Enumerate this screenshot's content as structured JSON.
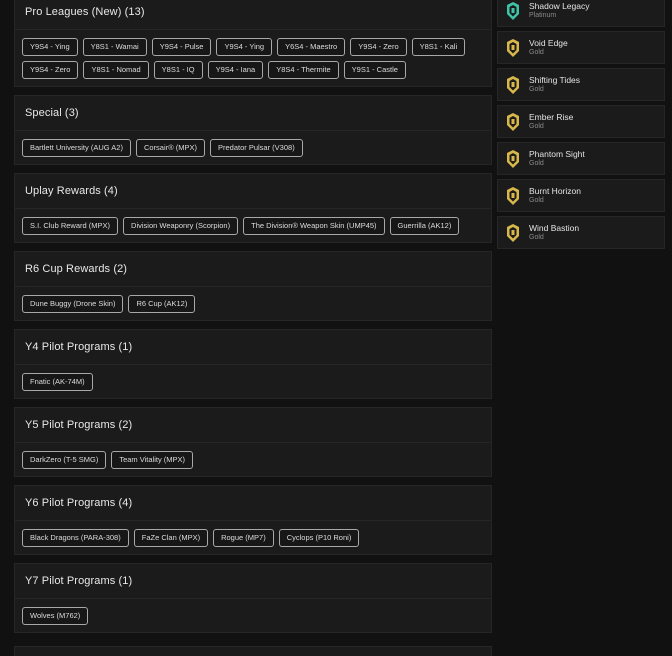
{
  "sections": [
    {
      "title": "Pro Leagues (New) (13)",
      "items": [
        "Y9S4 - Ying",
        "Y8S1 - Wamai",
        "Y9S4 - Pulse",
        "Y9S4 - Ying",
        "Y6S4 - Maestro",
        "Y9S4 - Zero",
        "Y8S1 - Kali",
        "Y9S4 - Zero",
        "Y8S1 - Nomad",
        "Y8S1 - IQ",
        "Y9S4 - Iana",
        "Y8S4 - Thermite",
        "Y9S1 - Castle"
      ]
    },
    {
      "title": "Special (3)",
      "items": [
        "Bartlett University (AUG A2)",
        "Corsair® (MPX)",
        "Predator Pulsar (V308)"
      ]
    },
    {
      "title": "Uplay Rewards (4)",
      "items": [
        "S.I. Club Reward (MPX)",
        "Division Weaponry (Scorpion)",
        "The Division® Weapon Skin (UMP45)",
        "Guerrilla (AK12)"
      ]
    },
    {
      "title": "R6 Cup Rewards (2)",
      "items": [
        "Dune Buggy (Drone Skin)",
        "R6 Cup (AK12)"
      ]
    },
    {
      "title": "Y4 Pilot Programs (1)",
      "items": [
        "Fnatic (AK-74M)"
      ]
    },
    {
      "title": "Y5 Pilot Programs (2)",
      "items": [
        "DarkZero (T-5 SMG)",
        "Team Vitality (MPX)"
      ]
    },
    {
      "title": "Y6 Pilot Programs (4)",
      "items": [
        "Black Dragons (PARA-308)",
        "FaZe Clan (MPX)",
        "Rogue (MP7)",
        "Cyclops (P10 Roni)"
      ]
    },
    {
      "title": "Y7 Pilot Programs (1)",
      "items": [
        "Wolves (M762)"
      ]
    }
  ],
  "seasons": [
    {
      "name": "Shadow Legacy",
      "rank": "Platinum",
      "color": "#3fc3a7"
    },
    {
      "name": "Void Edge",
      "rank": "Gold",
      "color": "#d8b84a"
    },
    {
      "name": "Shifting Tides",
      "rank": "Gold",
      "color": "#d8b84a"
    },
    {
      "name": "Ember Rise",
      "rank": "Gold",
      "color": "#d8b84a"
    },
    {
      "name": "Phantom Sight",
      "rank": "Gold",
      "color": "#d8b84a"
    },
    {
      "name": "Burnt Horizon",
      "rank": "Gold",
      "color": "#d8b84a"
    },
    {
      "name": "Wind Bastion",
      "rank": "Gold",
      "color": "#d8b84a"
    }
  ]
}
